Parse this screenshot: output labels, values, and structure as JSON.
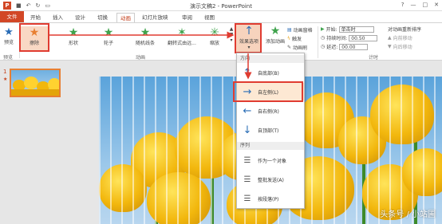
{
  "window": {
    "title": "演示文稿2 - PowerPoint",
    "controls": [
      "?",
      "—",
      "□",
      "✕"
    ]
  },
  "tabs": [
    "文件",
    "开始",
    "插入",
    "设计",
    "切换",
    "动画",
    "幻灯片放映",
    "审阅",
    "视图"
  ],
  "ribbon": {
    "preview_label": "预览",
    "preview_group": "预览",
    "animation_group": "动画",
    "timing_group": "计时",
    "animations": [
      "擦除",
      "形状",
      "轮子",
      "随机线条",
      "翻转式由远...",
      "缩放"
    ],
    "effect_options_label": "效果选项",
    "add_animation_label": "添加动画",
    "animation_pane_label": "动画窗格",
    "trigger_label": "触发",
    "animation_painter_label": "动画刷",
    "start_label": "开始:",
    "start_value": "单击时",
    "duration_label": "持续时间:",
    "duration_value": "00.50",
    "delay_label": "延迟:",
    "delay_value": "00.00",
    "reorder_label": "对动画重新排序",
    "move_earlier_label": "向前移动",
    "move_later_label": "向后移动"
  },
  "thumbnail": {
    "number": "1",
    "star": "★"
  },
  "dropdown": {
    "direction_header": "方向",
    "sequence_header": "序列",
    "items": [
      "自底部(B)",
      "自左侧(L)",
      "自右侧(R)",
      "自顶部(T)",
      "作为一个对象",
      "整批发送(A)",
      "按段落(P)"
    ]
  },
  "watermark": "头条号 / 小站圃",
  "colors": {
    "accent": "#d24726",
    "highlight": "#e03c31",
    "arrow": "#2a6db6"
  }
}
